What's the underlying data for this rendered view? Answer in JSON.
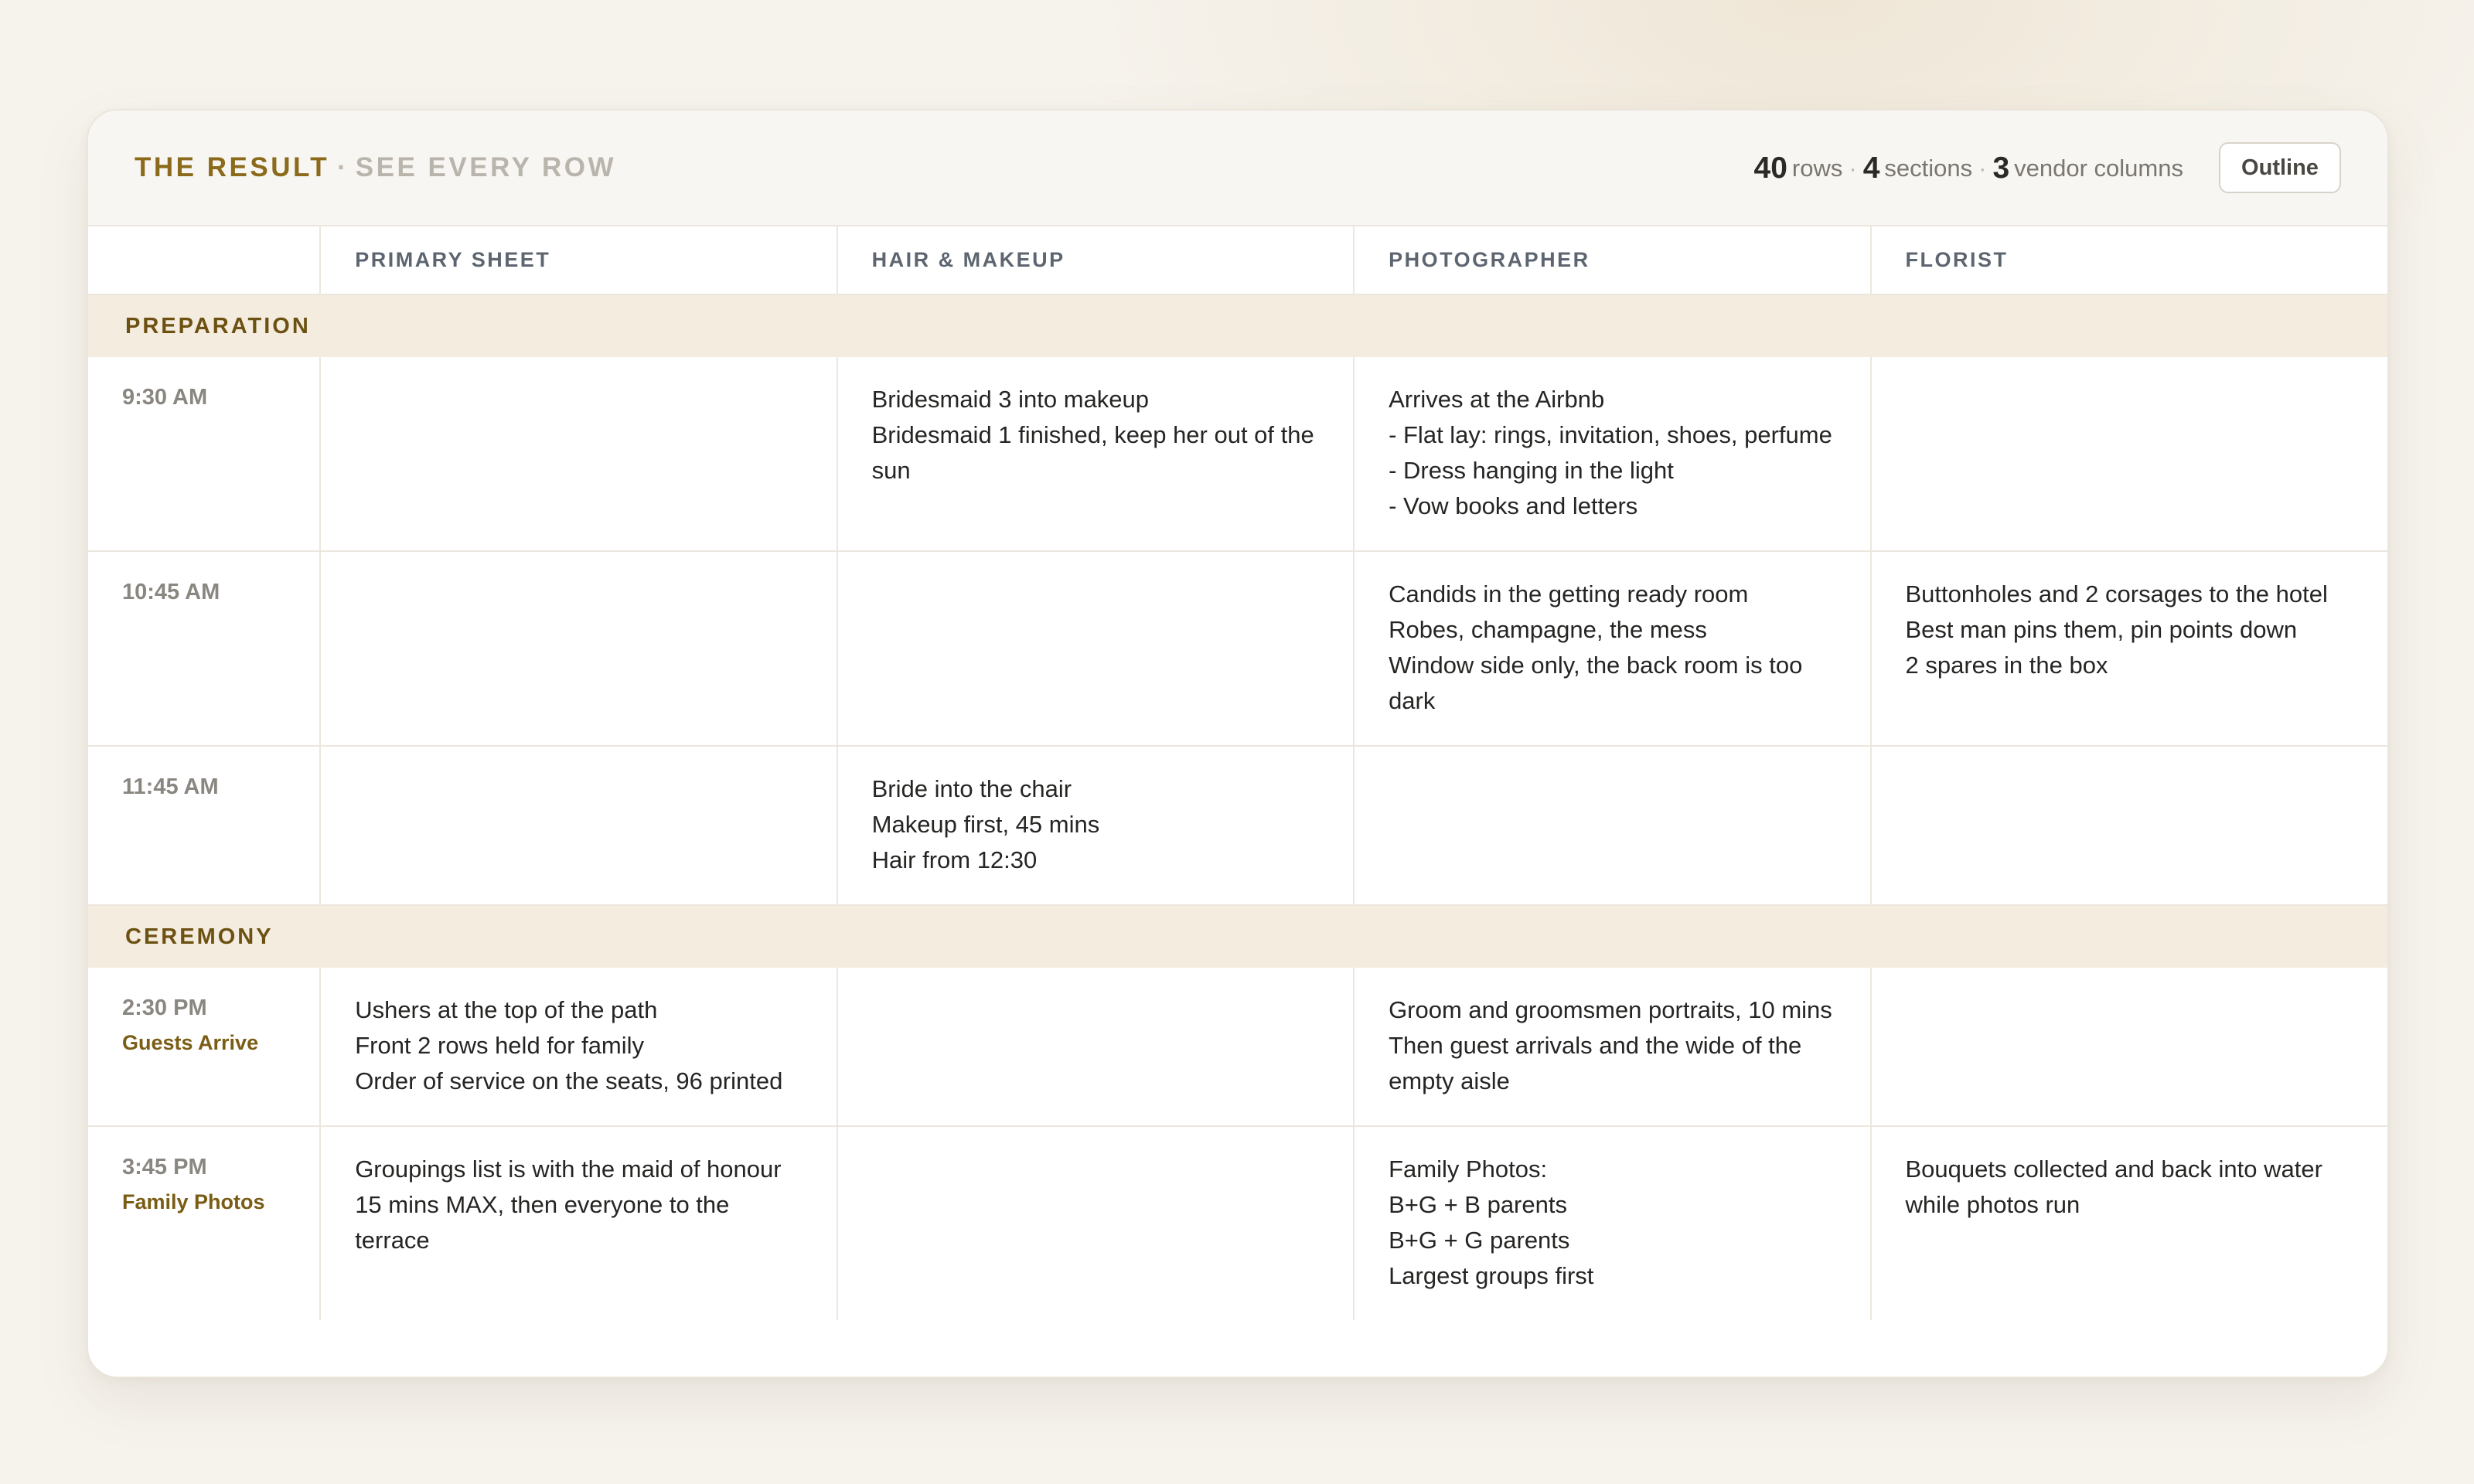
{
  "header": {
    "title_main": "THE RESULT",
    "title_sep": "·",
    "title_sub": "SEE EVERY ROW",
    "stats": {
      "rows_count": "40",
      "rows_label": "rows",
      "sections_count": "4",
      "sections_label": "sections",
      "vendor_count": "3",
      "vendor_label": "vendor columns",
      "separator": "·"
    },
    "outline_button": "Outline"
  },
  "columns": [
    "",
    "PRIMARY SHEET",
    "HAIR & MAKEUP",
    "PHOTOGRAPHER",
    "FLORIST"
  ],
  "sections": [
    {
      "name": "PREPARATION",
      "rows": [
        {
          "time": "9:30 AM",
          "label": "",
          "primary": [],
          "hair_makeup": [
            "Bridesmaid 3 into makeup",
            "Bridesmaid 1 finished, keep her out of the sun"
          ],
          "photographer": [
            "Arrives at the Airbnb",
            "- Flat lay: rings, invitation, shoes, perfume",
            "- Dress hanging in the light",
            "- Vow books and letters"
          ],
          "florist": []
        },
        {
          "time": "10:45 AM",
          "label": "",
          "primary": [],
          "hair_makeup": [],
          "photographer": [
            "Candids in the getting ready room",
            "Robes, champagne, the mess",
            "Window side only, the back room is too dark"
          ],
          "florist": [
            "Buttonholes and 2 corsages to the hotel",
            "Best man pins them, pin points down",
            "2 spares in the box"
          ]
        },
        {
          "time": "11:45 AM",
          "label": "",
          "primary": [],
          "hair_makeup": [
            "Bride into the chair",
            "Makeup first, 45 mins",
            "Hair from 12:30"
          ],
          "photographer": [],
          "florist": []
        }
      ]
    },
    {
      "name": "CEREMONY",
      "rows": [
        {
          "time": "2:30 PM",
          "label": "Guests Arrive",
          "primary": [
            "Ushers at the top of the path",
            "Front 2 rows held for family",
            "Order of service on the seats, 96 printed"
          ],
          "hair_makeup": [],
          "photographer": [
            "Groom and groomsmen portraits, 10 mins",
            "Then guest arrivals and the wide of the empty aisle"
          ],
          "florist": []
        },
        {
          "time": "3:45 PM",
          "label": "Family Photos",
          "primary": [
            "Groupings list is with the maid of honour",
            "15 mins MAX, then everyone to the terrace"
          ],
          "hair_makeup": [],
          "photographer": [
            "Family Photos:",
            "B+G + B parents",
            "B+G + G parents",
            "Largest groups first"
          ],
          "florist": [
            "Bouquets collected and back into water while photos run"
          ]
        }
      ]
    }
  ]
}
